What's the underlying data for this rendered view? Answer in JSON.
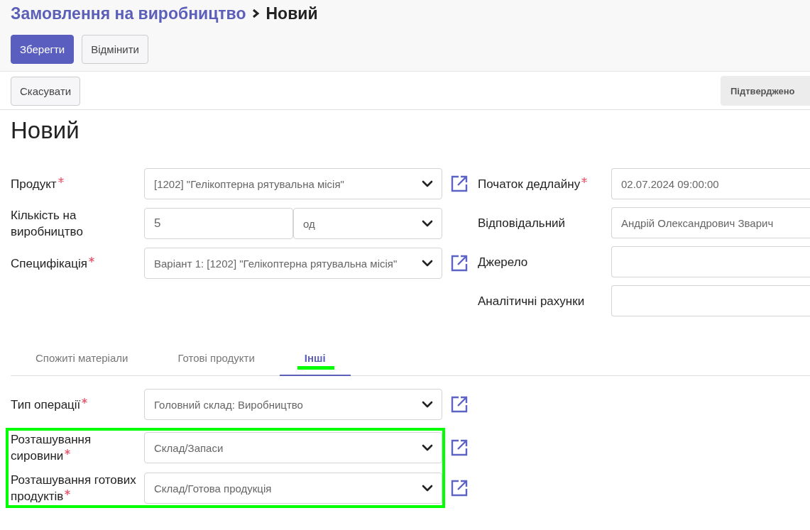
{
  "breadcrumb": {
    "parent": "Замовлення на виробництво",
    "current": "Новий"
  },
  "actions": [
    {
      "label": "Зберегти",
      "kind": "primary"
    },
    {
      "label": "Відмінити",
      "kind": "secondary"
    }
  ],
  "status_actions": [
    {
      "label": "Скасувати"
    }
  ],
  "stage": {
    "label": "Підтверджено"
  },
  "record_title": "Новий",
  "left_fields": [
    {
      "label": "Продукт",
      "required": true,
      "kind": "select",
      "value": "[1202] \"Гелікоптерна рятувальна місія\"",
      "link": true
    },
    {
      "label": "Кількість на виробництво",
      "required": false,
      "kind": "quantity",
      "value": "5",
      "unit": "од",
      "link": false
    },
    {
      "label": "Специфікація",
      "required": true,
      "kind": "select",
      "value": "Варіант 1: [1202] \"Гелікоптерна рятувальна місія\"",
      "link": true
    }
  ],
  "right_fields": [
    {
      "label": "Початок дедлайну",
      "required": true,
      "value": "02.07.2024 09:00:00"
    },
    {
      "label": "Відповідальний",
      "required": false,
      "value": "Андрій Олександрович Зварич"
    },
    {
      "label": "Джерело",
      "required": false
    },
    {
      "label": "Аналітичні рахунки",
      "required": false
    }
  ],
  "tabs": [
    {
      "label": "Спожиті матеріали",
      "selected": false,
      "highlighted": false
    },
    {
      "label": "Готові продукти",
      "selected": false,
      "highlighted": false
    },
    {
      "label": "Інші",
      "selected": true,
      "highlighted": true
    }
  ],
  "tab_fields": [
    {
      "label": "Тип операції",
      "required": true,
      "value": "Головний склад: Виробництво",
      "highlighted": false
    },
    {
      "label": "Розташування сировини",
      "required": true,
      "value": "Склад/Запаси",
      "highlighted": true
    },
    {
      "label": "Розташування готових продуктів",
      "required": true,
      "value": "Склад/Готова продукція",
      "highlighted": true
    }
  ]
}
